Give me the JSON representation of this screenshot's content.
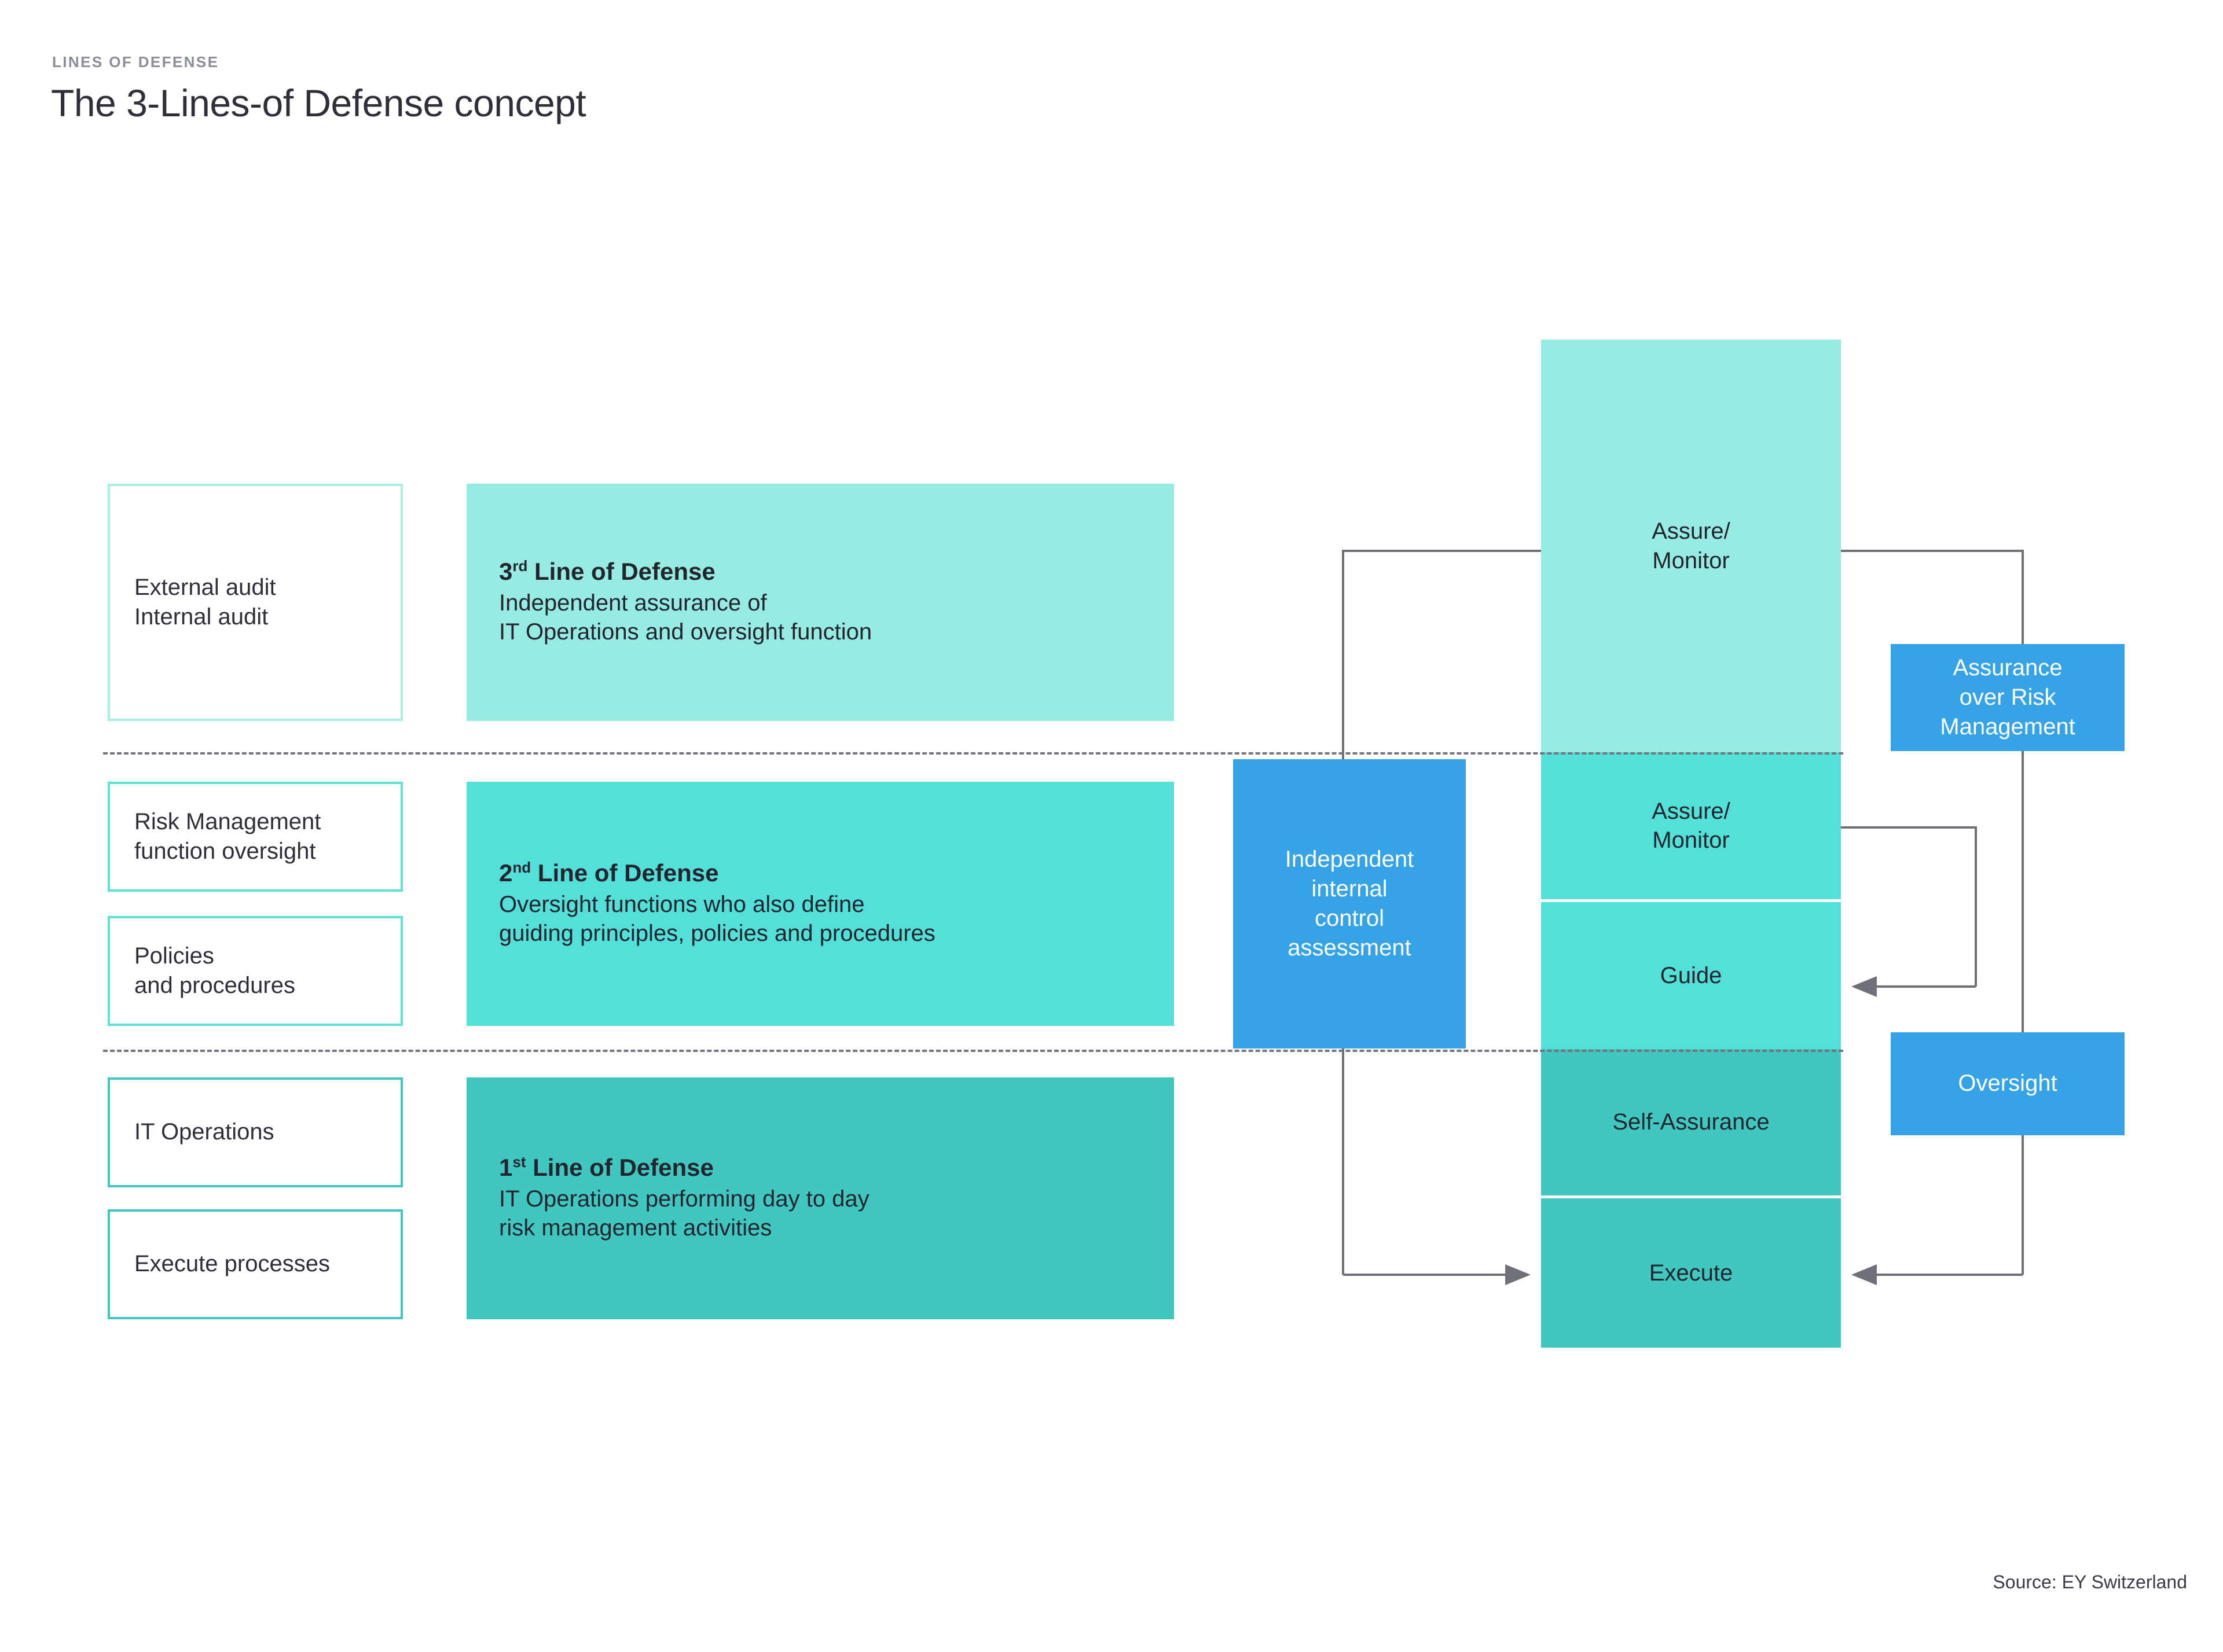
{
  "header": {
    "eyebrow": "LINES OF DEFENSE",
    "title": "The 3-Lines-of Defense concept"
  },
  "colors": {
    "light_aqua": "#96ece2",
    "turquoise": "#52e0d8",
    "teal": "#3fc7c0",
    "blue": "#35a3e5",
    "outline_light": "#a8f0e4",
    "outline_turquoise": "#5fe2d6",
    "outline_teal": "#3fc7c0",
    "connector": "#6f7079",
    "text_dark": "#2e2f3a",
    "eyebrow_gray": "#8b8d98"
  },
  "left_boxes": [
    {
      "name": "audit",
      "text": "External audit\nInternal audit"
    },
    {
      "name": "risk-management-oversight",
      "text": "Risk Management\nfunction oversight"
    },
    {
      "name": "policies-procedures",
      "text": "Policies\nand procedures"
    },
    {
      "name": "it-operations",
      "text": "IT Operations"
    },
    {
      "name": "execute-processes",
      "text": "Execute processes"
    }
  ],
  "lines_of_defense": [
    {
      "name": "third-line",
      "ordinal": "3",
      "ordinal_suffix": "rd",
      "heading_rest": " Line of Defense",
      "body": "Independent assurance of\nIT Operations and oversight function"
    },
    {
      "name": "second-line",
      "ordinal": "2",
      "ordinal_suffix": "nd",
      "heading_rest": " Line of Defense",
      "body": "Oversight functions who also define\nguiding principles, policies and procedures"
    },
    {
      "name": "first-line",
      "ordinal": "1",
      "ordinal_suffix": "st",
      "heading_rest": " Line of Defense",
      "body": "IT Operations performing day to day\nrisk management activities"
    }
  ],
  "assessment_box": {
    "label": "Independent\ninternal\ncontrol\nassessment"
  },
  "capability_stack": [
    {
      "name": "assure-monitor-third",
      "label": "Assure/\nMonitor"
    },
    {
      "name": "assure-monitor-second",
      "label": "Assure/\nMonitor"
    },
    {
      "name": "guide",
      "label": "Guide"
    },
    {
      "name": "self-assurance",
      "label": "Self-Assurance"
    },
    {
      "name": "execute",
      "label": "Execute"
    }
  ],
  "right_boxes": [
    {
      "name": "assurance-over-risk-management",
      "label": "Assurance\nover Risk\nManagement"
    },
    {
      "name": "oversight",
      "label": "Oversight"
    }
  ],
  "footer": {
    "source": "Source: EY Switzerland"
  }
}
